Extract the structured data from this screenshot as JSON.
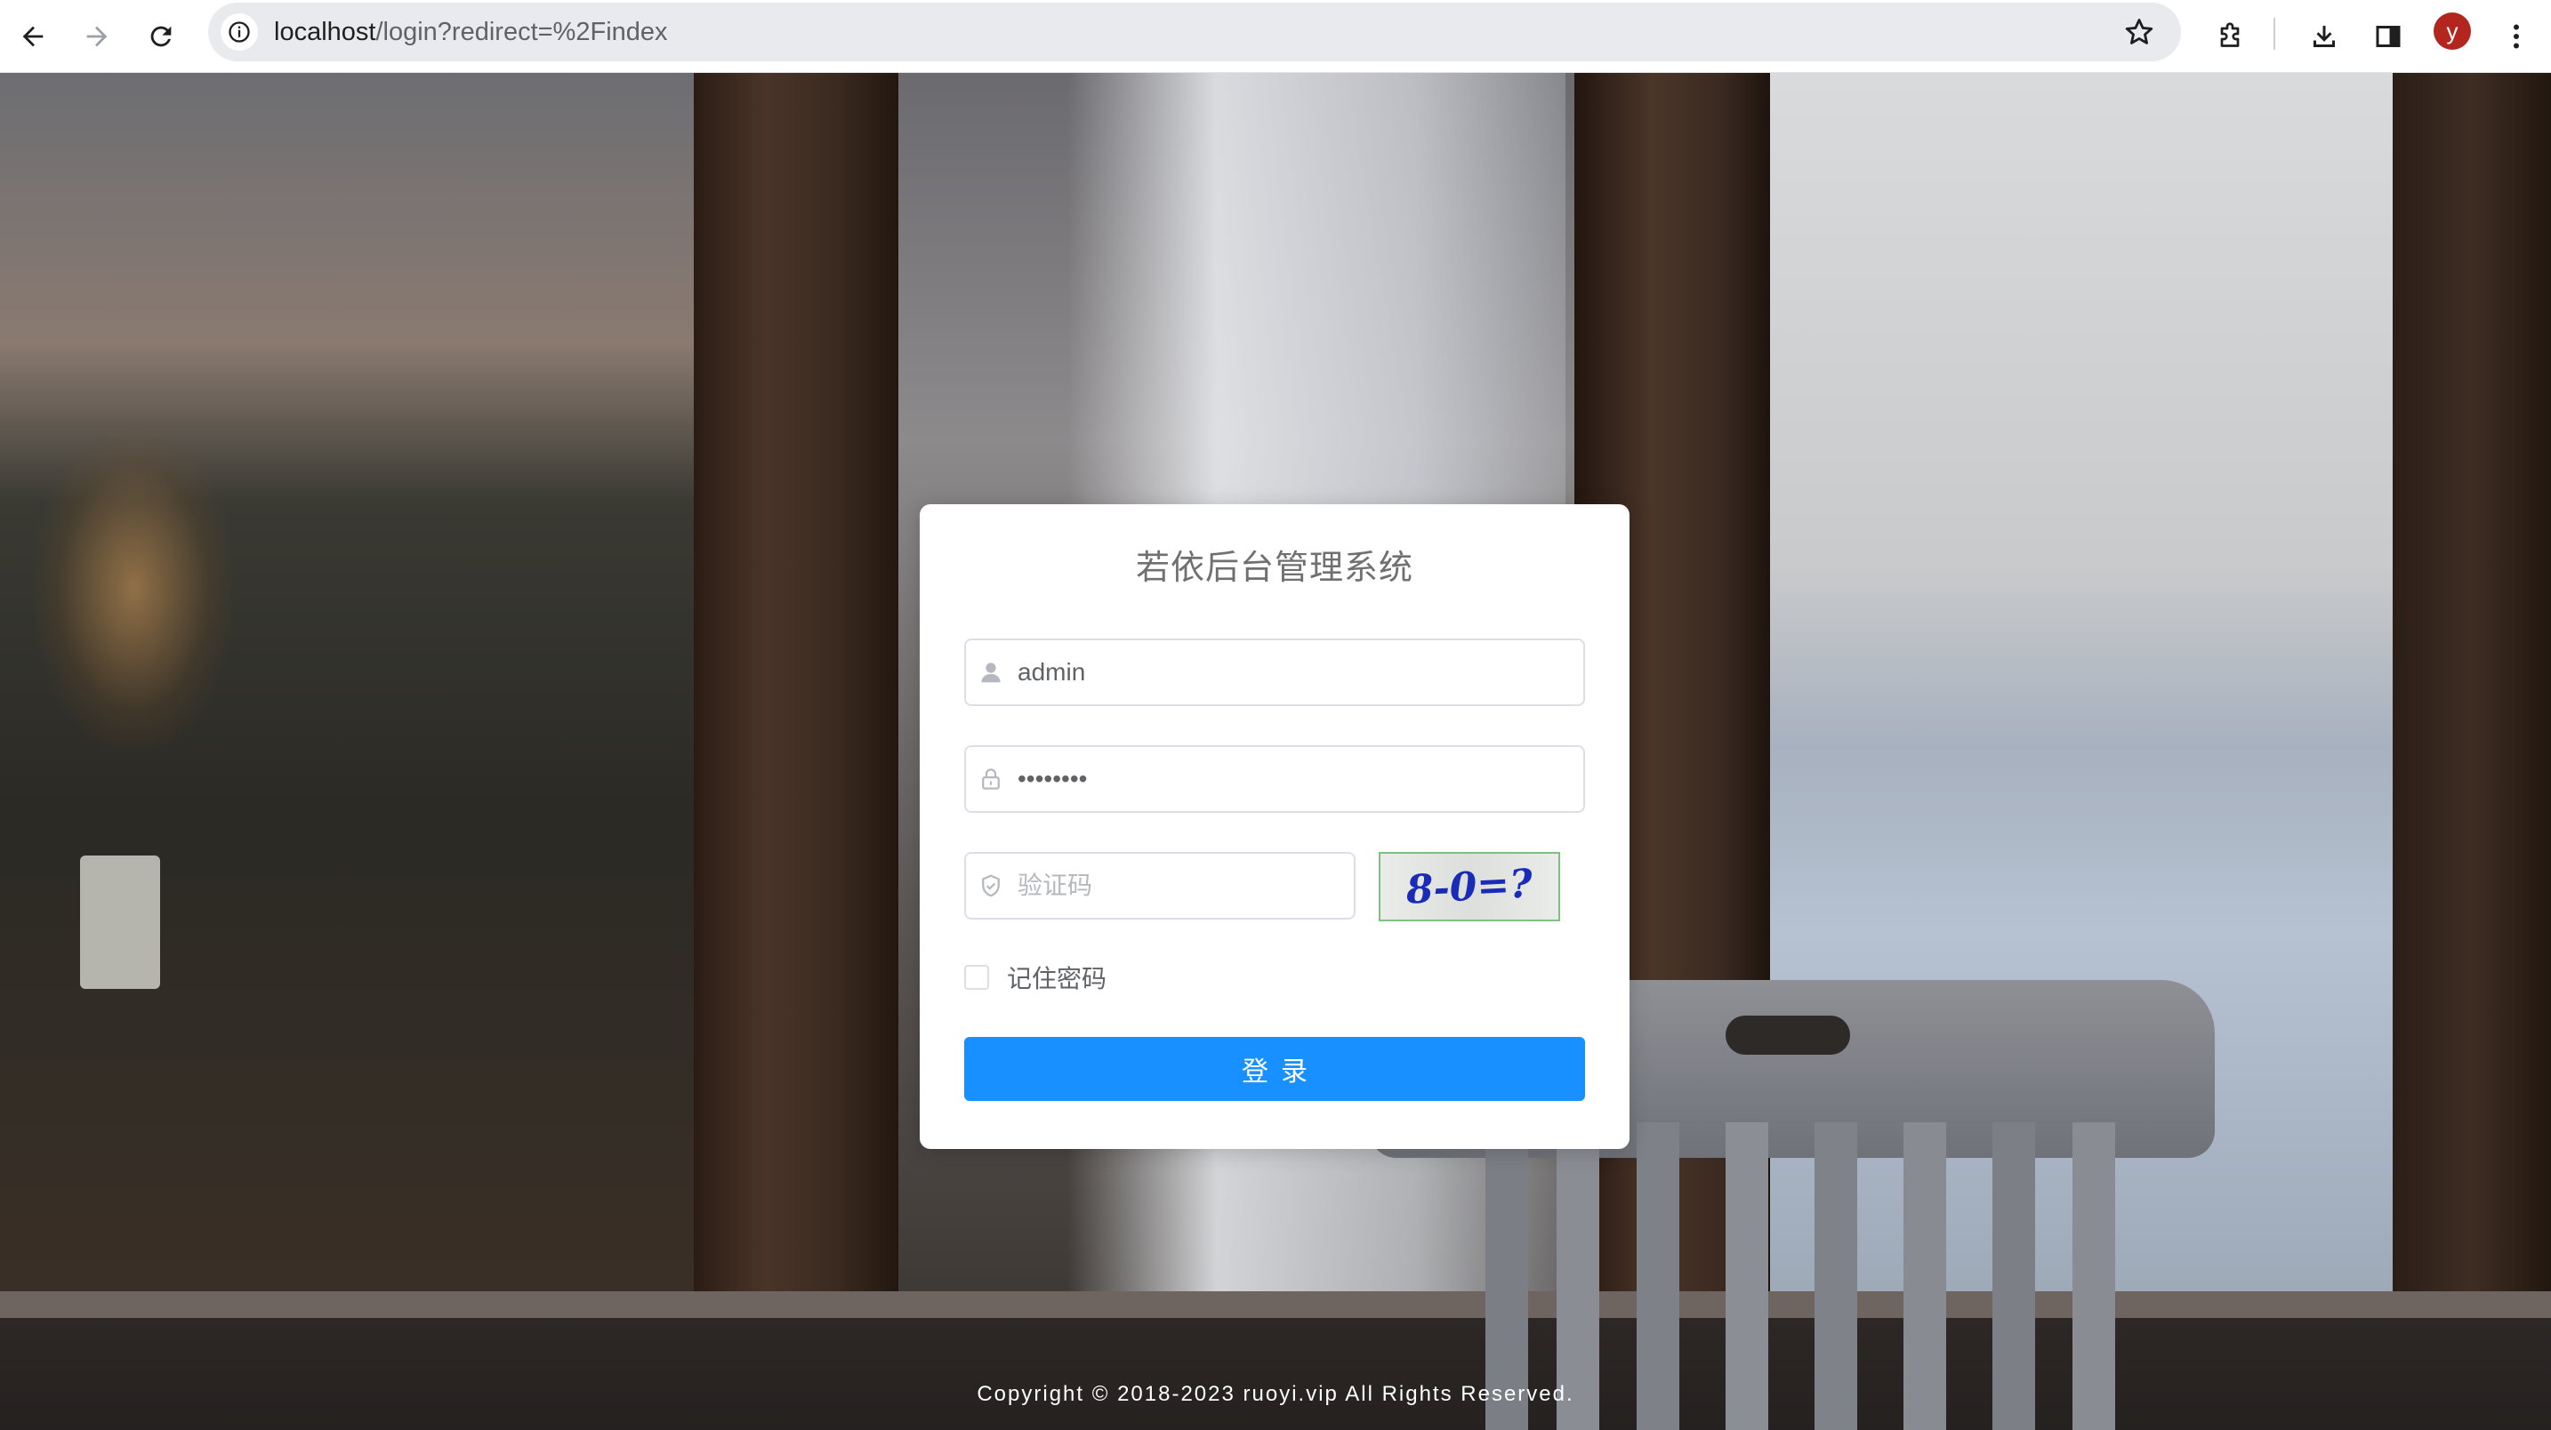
{
  "browser": {
    "url_host": "localhost",
    "url_path": "/login?redirect=%2Findex",
    "profile_initial": "y",
    "icons": {
      "back": "arrow-left-icon",
      "forward": "arrow-right-icon",
      "reload": "reload-icon",
      "site_info": "info-icon",
      "bookmark": "star-icon",
      "extensions": "puzzle-icon",
      "downloads": "download-icon",
      "side_panel": "side-panel-icon",
      "menu": "kebab-menu-icon"
    },
    "colors": {
      "avatar": "#b3261e",
      "omnibox": "#e8eaed"
    }
  },
  "login": {
    "title": "若依后台管理系统",
    "username_value": "admin",
    "password_value": "••••••••",
    "captcha_placeholder": "验证码",
    "captcha_text": "8-0=?",
    "remember_label": "记住密码",
    "remember_checked": false,
    "submit_label": "登录",
    "colors": {
      "primary": "#1890ff",
      "card": "#ffffff"
    }
  },
  "footer": {
    "copyright": "Copyright © 2018-2023 ruoyi.vip All Rights Reserved."
  }
}
